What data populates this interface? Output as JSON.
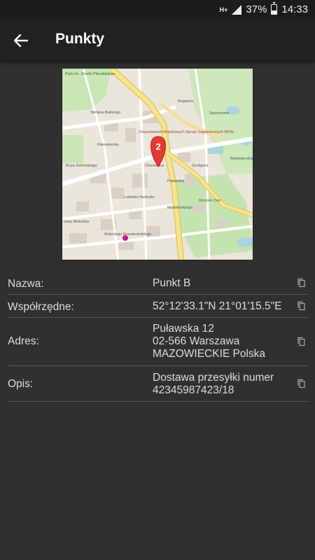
{
  "status": {
    "network": "H+",
    "battery": "37%",
    "time": "14:33"
  },
  "appbar": {
    "title": "Punkty"
  },
  "map": {
    "marker_label": "2",
    "labels": {
      "park": "Park im. Józefa Piłsudskiego",
      "department": "Departament Wojskowych Spraw Zagranicznych MON",
      "morskie_oko": "Morskie Oko",
      "gary": "Gary Mokotów",
      "bagatela": "Bagatela",
      "rakowiecka": "Rakowiecka",
      "pulawska": "Puławska",
      "spacerowa": "Spacerowa",
      "batorego": "Stefana Batorego",
      "boya": "Boya-Żeleńskiego",
      "lucka": "Ludwika Narbutta",
      "olszewska": "Olszewska",
      "grottgera": "Grottgera",
      "belwederska": "Belwederska",
      "madalinskiego": "Madalińskiego",
      "antoniego": "Antoniego Nowakowskiego"
    }
  },
  "details": [
    {
      "label": "Nazwa:",
      "value": "Punkt B"
    },
    {
      "label": "Współrzędne:",
      "value": "52°12'33.1\"N 21°01'15.5\"E"
    },
    {
      "label": "Adres:",
      "value_lines": [
        "Puławska 12",
        "02-566 Warszawa",
        "MAZOWIECKIE Polska"
      ]
    },
    {
      "label": "Opis:",
      "value_lines": [
        "Dostawa przesyłki numer",
        "42345987423/18"
      ]
    }
  ]
}
